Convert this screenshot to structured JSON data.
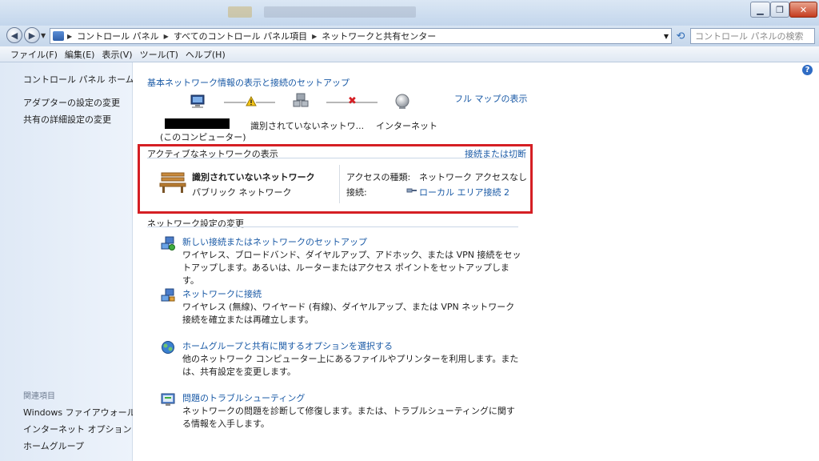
{
  "address": {
    "crumbs": [
      "コントロール パネル",
      "すべてのコントロール パネル項目",
      "ネットワークと共有センター"
    ],
    "search_placeholder": "コントロール パネルの検索"
  },
  "menu": [
    "ファイル(F)",
    "編集(E)",
    "表示(V)",
    "ツール(T)",
    "ヘルプ(H)"
  ],
  "sidebar": {
    "links": [
      "コントロール パネル ホーム",
      "アダプターの設定の変更",
      "共有の詳細設定の変更"
    ],
    "related_caption": "関連項目",
    "related": [
      "Windows ファイアウォール",
      "インターネット オプション",
      "ホームグループ"
    ]
  },
  "main": {
    "heading": "基本ネットワーク情報の表示と接続のセットアップ",
    "full_map_link": "フル マップの表示",
    "map": {
      "computer_label": "(このコンピューター)",
      "network_label": "識別されていないネットワ...",
      "internet_label": "インターネット"
    },
    "active": {
      "section_title": "アクティブなネットワークの表示",
      "connect_link": "接続または切断",
      "network_name": "識別されていないネットワーク",
      "network_type": "パブリック ネットワーク",
      "access_label": "アクセスの種類:",
      "access_value": "ネットワーク アクセスなし",
      "conn_label": "接続:",
      "conn_value": "ローカル エリア接続 2"
    },
    "change": {
      "section_title": "ネットワーク設定の変更",
      "tasks": [
        {
          "title": "新しい接続またはネットワークのセットアップ",
          "desc": "ワイヤレス、ブロードバンド、ダイヤルアップ、アドホック、または VPN 接続をセットアップします。あるいは、ルーターまたはアクセス ポイントをセットアップします。",
          "icon": "network-setup-icon"
        },
        {
          "title": "ネットワークに接続",
          "desc": "ワイヤレス (無線)、ワイヤード (有線)、ダイヤルアップ、または VPN ネットワーク接続を確立または再確立します。",
          "icon": "connect-network-icon"
        },
        {
          "title": "ホームグループと共有に関するオプションを選択する",
          "desc": "他のネットワーク コンピューター上にあるファイルやプリンターを利用します。または、共有設定を変更します。",
          "icon": "homegroup-icon"
        },
        {
          "title": "問題のトラブルシューティング",
          "desc": "ネットワークの問題を診断して修復します。または、トラブルシューティングに関する情報を入手します。",
          "icon": "troubleshoot-icon"
        }
      ]
    }
  }
}
